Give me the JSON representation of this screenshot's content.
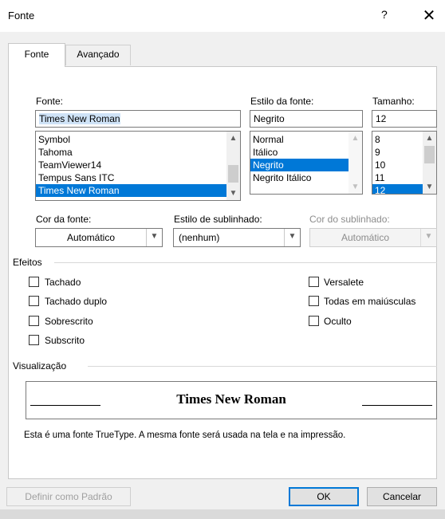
{
  "dialog": {
    "title": "Fonte",
    "help": "?",
    "close": "✕"
  },
  "tabs": [
    {
      "label": "Fonte",
      "active": true
    },
    {
      "label": "Avançado",
      "active": false
    }
  ],
  "font": {
    "label": "Fonte:",
    "value": "Times New Roman",
    "items": [
      "Symbol",
      "Tahoma",
      "TeamViewer14",
      "Tempus Sans ITC",
      "Times New Roman"
    ],
    "selected": "Times New Roman"
  },
  "style": {
    "label": "Estilo da fonte:",
    "value": "Negrito",
    "items": [
      "Normal",
      "Itálico",
      "Negrito",
      "Negrito Itálico"
    ],
    "selected": "Negrito"
  },
  "size": {
    "label": "Tamanho:",
    "value": "12",
    "items": [
      "8",
      "9",
      "10",
      "11",
      "12"
    ],
    "selected": "12"
  },
  "font_color": {
    "label": "Cor da fonte:",
    "value": "Automático"
  },
  "underline_style": {
    "label": "Estilo de sublinhado:",
    "value": "(nenhum)"
  },
  "underline_color": {
    "label": "Cor do sublinhado:",
    "value": "Automático"
  },
  "effects": {
    "title": "Efeitos",
    "left": [
      "Tachado",
      "Tachado duplo",
      "Sobrescrito",
      "Subscrito"
    ],
    "right": [
      "Versalete",
      "Todas em maiúsculas",
      "Oculto"
    ]
  },
  "preview": {
    "title": "Visualização",
    "sample": "Times New Roman",
    "note": "Esta é uma fonte TrueType. A mesma fonte será usada na tela e na impressão."
  },
  "buttons": {
    "set_default": "Definir como Padrão",
    "ok": "OK",
    "cancel": "Cancelar"
  },
  "colors": {
    "selection": "#0078d7",
    "field_highlight": "#cfe3f7",
    "accent": "#0078d7"
  }
}
